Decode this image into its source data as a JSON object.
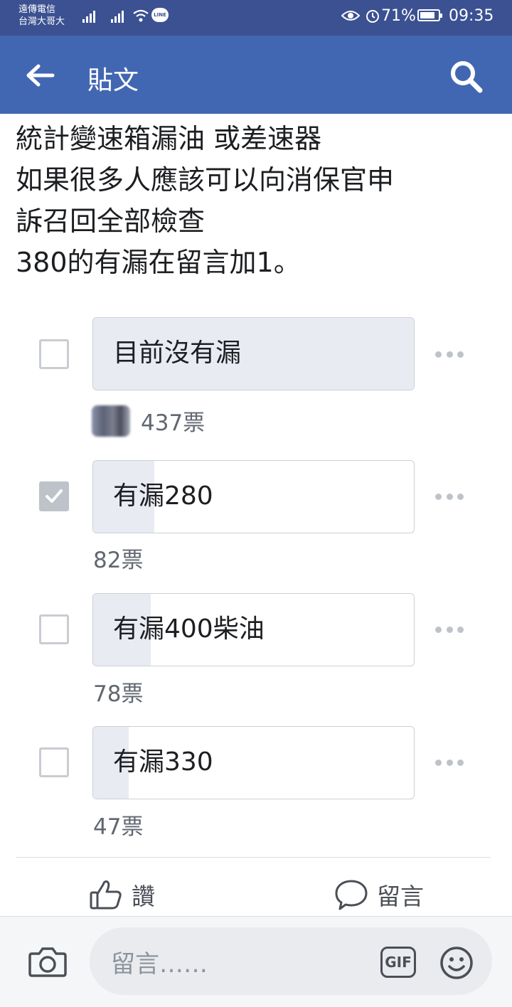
{
  "status_bar": {
    "carrier_line1": "遠傳電信",
    "carrier_line2": "台灣大哥大",
    "line_badge": "LINE",
    "battery": "71%",
    "time": "09:35"
  },
  "header": {
    "title": "貼文"
  },
  "post": {
    "lines": [
      "統計變速箱漏油 或差速器",
      "如果很多人應該可以向消保官申",
      "訴召回全部檢查",
      "380的有漏在留言加1。"
    ]
  },
  "poll": {
    "options": [
      {
        "label": "目前沒有漏",
        "votes": "437票",
        "vote_fraction": 1.0,
        "checked": false
      },
      {
        "label": "有漏280",
        "votes": "82票",
        "vote_fraction": 0.19,
        "checked": true
      },
      {
        "label": "有漏400柴油",
        "votes": "78票",
        "vote_fraction": 0.18,
        "checked": false
      },
      {
        "label": "有漏330",
        "votes": "47票",
        "vote_fraction": 0.11,
        "checked": false
      }
    ]
  },
  "actions": {
    "like_label": "讚",
    "comment_label": "留言"
  },
  "composer": {
    "placeholder": "留言……",
    "gif_label": "GIF"
  },
  "colors": {
    "header": "#4267b2",
    "status_bar": "#3b5192",
    "poll_fill": "#e9ebf3"
  }
}
